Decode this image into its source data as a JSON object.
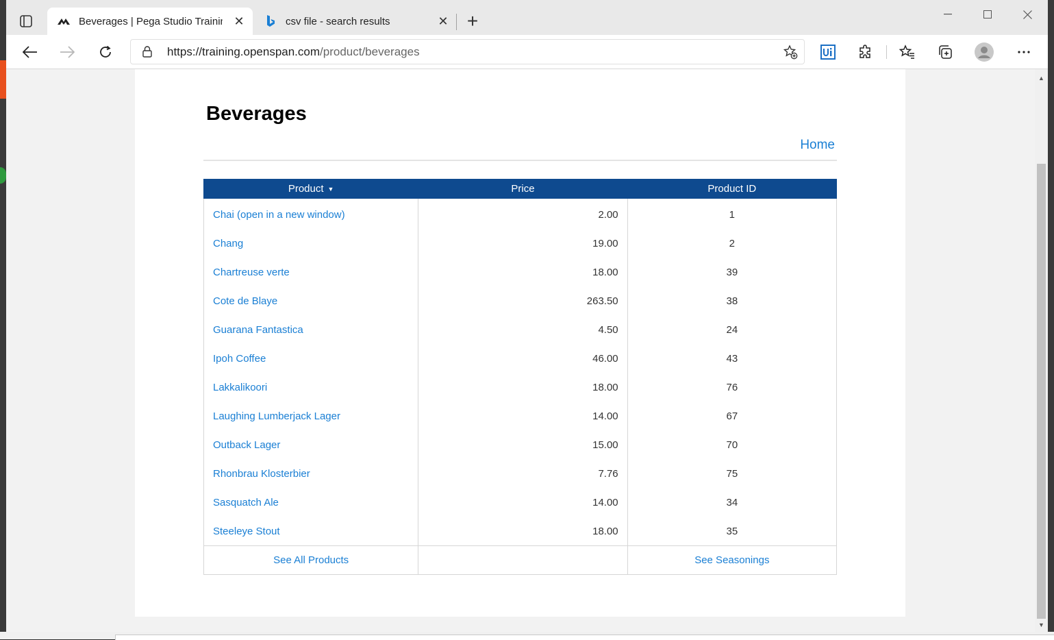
{
  "browser": {
    "tabs": [
      {
        "title": "Beverages | Pega Studio Training",
        "active": true,
        "favicon": "pega-icon"
      },
      {
        "title": "csv file - search results",
        "active": false,
        "favicon": "bing-icon"
      }
    ],
    "close_glyph": "✕",
    "new_tab_glyph": "+",
    "url_host": "https://training.openspan.com",
    "url_path": "/product/beverages",
    "accent": "#0e4a8f",
    "link_color": "#1a7fd4"
  },
  "page": {
    "title": "Beverages",
    "home_link": "Home"
  },
  "table": {
    "headers": {
      "product": "Product",
      "sort_indicator": "▼",
      "price": "Price",
      "product_id": "Product ID"
    },
    "rows": [
      {
        "name": "Chai  (open in a new window)",
        "price": "2.00",
        "id": "1"
      },
      {
        "name": "Chang",
        "price": "19.00",
        "id": "2"
      },
      {
        "name": "Chartreuse verte",
        "price": "18.00",
        "id": "39"
      },
      {
        "name": "Cote de Blaye",
        "price": "263.50",
        "id": "38"
      },
      {
        "name": "Guarana Fantastica",
        "price": "4.50",
        "id": "24"
      },
      {
        "name": "Ipoh Coffee",
        "price": "46.00",
        "id": "43"
      },
      {
        "name": "Lakkalikoori",
        "price": "18.00",
        "id": "76"
      },
      {
        "name": "Laughing Lumberjack Lager",
        "price": "14.00",
        "id": "67"
      },
      {
        "name": "Outback Lager",
        "price": "15.00",
        "id": "70"
      },
      {
        "name": "Rhonbrau Klosterbier",
        "price": "7.76",
        "id": "75"
      },
      {
        "name": "Sasquatch Ale",
        "price": "14.00",
        "id": "34"
      },
      {
        "name": "Steeleye Stout",
        "price": "18.00",
        "id": "35"
      }
    ],
    "footer": {
      "see_all": "See All Products",
      "see_other": "See Seasonings"
    }
  }
}
